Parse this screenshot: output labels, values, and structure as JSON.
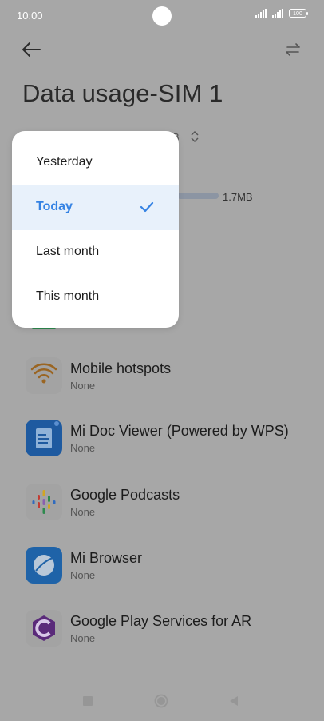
{
  "status_bar": {
    "time": "10:00",
    "battery": "100"
  },
  "header": {
    "title": "Data usage-SIM 1"
  },
  "background": {
    "range_value_partial": "B",
    "usage_value": "1.7MB"
  },
  "menu": {
    "items": [
      {
        "label": "Yesterday",
        "selected": false
      },
      {
        "label": "Today",
        "selected": true
      },
      {
        "label": "Last month",
        "selected": false
      },
      {
        "label": "This month",
        "selected": false
      }
    ]
  },
  "apps": [
    {
      "name": "Mobile hotspots",
      "usage": "None",
      "icon": "wifi-hotspot-icon"
    },
    {
      "name": "Mi Doc Viewer (Powered by WPS)",
      "usage": "None",
      "icon": "document-icon"
    },
    {
      "name": "Google Podcasts",
      "usage": "None",
      "icon": "podcast-icon"
    },
    {
      "name": "Mi Browser",
      "usage": "None",
      "icon": "browser-icon"
    },
    {
      "name": "Google Play Services for AR",
      "usage": "None",
      "icon": "ar-services-icon"
    }
  ],
  "colors": {
    "accent": "#3482e3",
    "overlay_background": "#a7a7a7",
    "menu_selected_bg": "#e8f1fb"
  }
}
